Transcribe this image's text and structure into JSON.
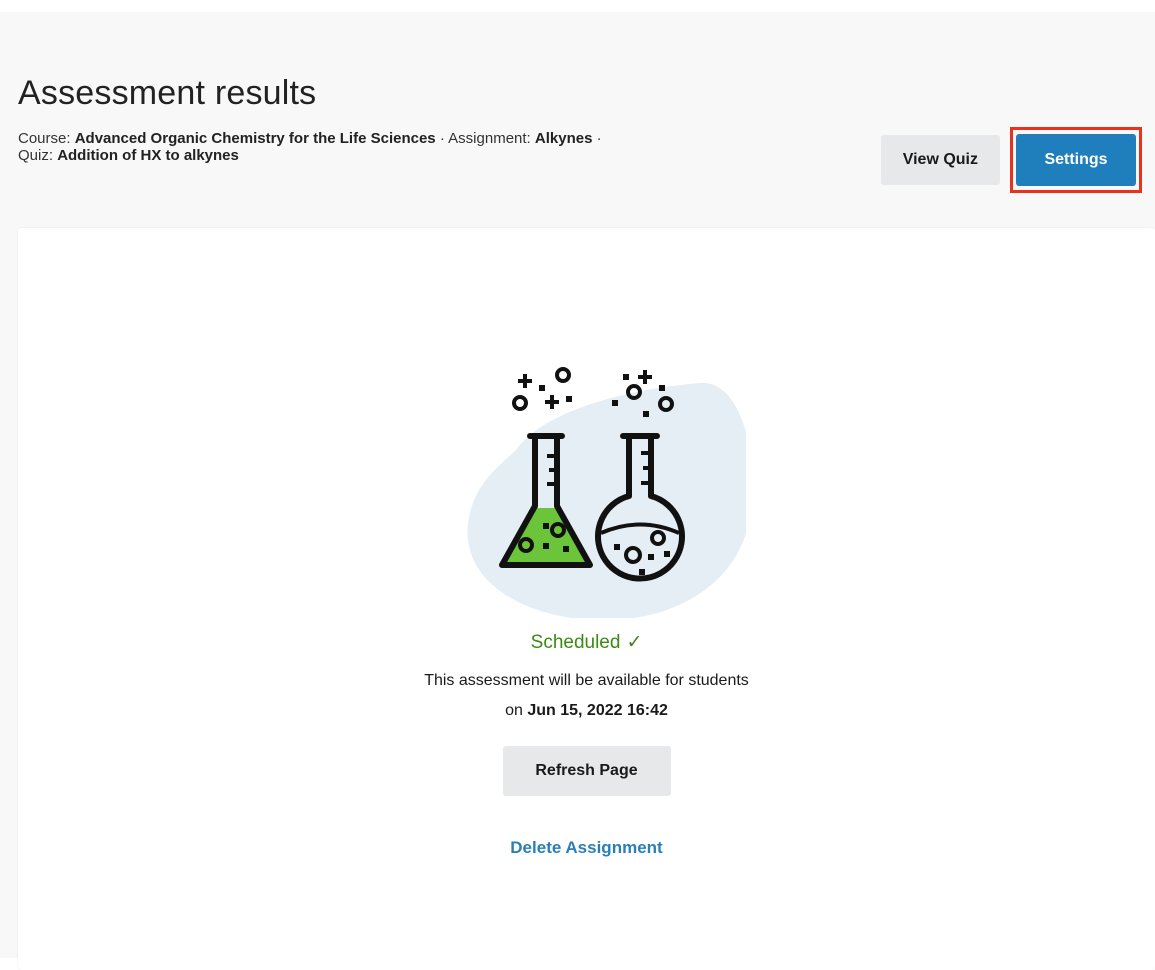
{
  "header": {
    "title": "Assessment results",
    "breadcrumb": {
      "course_label": "Course:",
      "course_value": "Advanced Organic Chemistry for the Life Sciences",
      "separator": "·",
      "assignment_label": "Assignment:",
      "assignment_value": "Alkynes",
      "quiz_label": "Quiz:",
      "quiz_value": "Addition of HX to alkynes"
    },
    "view_quiz_label": "View Quiz",
    "settings_label": "Settings"
  },
  "main": {
    "illustration_icon": "chemistry-flasks-icon",
    "status_label": "Scheduled",
    "status_icon": "check-icon",
    "status_color": "#3c8a14",
    "availability_text": "This assessment will be available for students",
    "availability_prefix": "on",
    "availability_date": "Jun 15, 2022 16:42",
    "refresh_label": "Refresh Page",
    "delete_label": "Delete Assignment"
  },
  "colors": {
    "primary": "#1f7fbd",
    "highlight": "#e8321e",
    "liquid": "#6cc43a",
    "blob": "#e4eef4",
    "link": "#2a7fb5"
  }
}
